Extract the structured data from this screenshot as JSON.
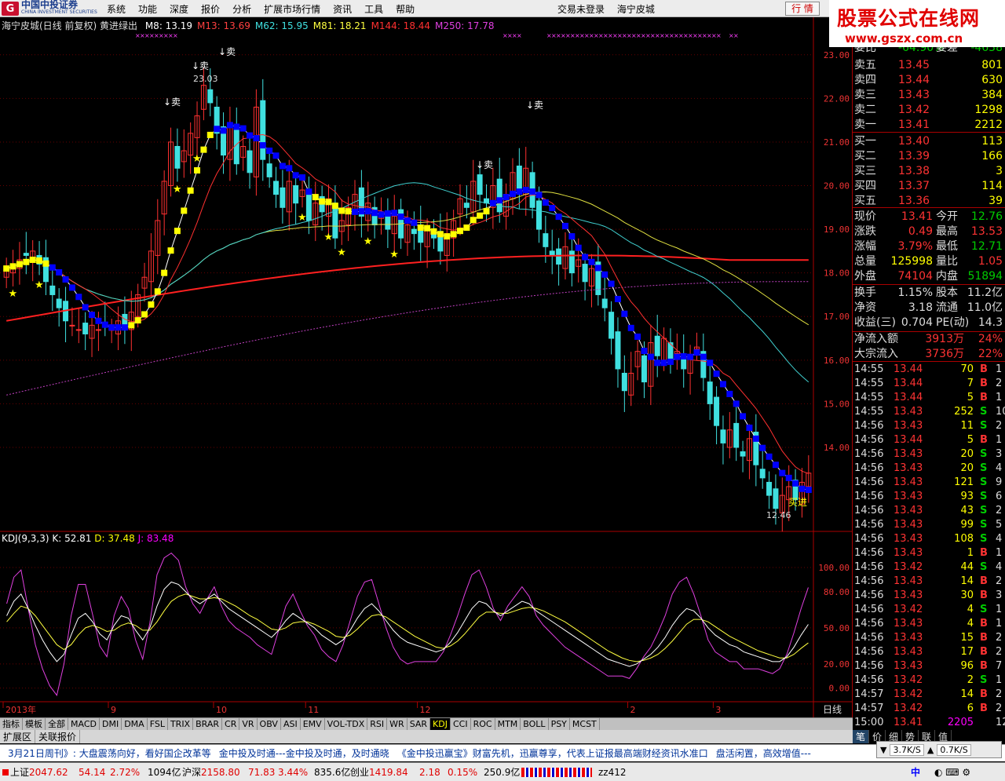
{
  "menubar": {
    "logo": "中国中投证券",
    "logo_sub": "CHINA INVESTMENT SECURITIES",
    "items": [
      "系统",
      "功能",
      "深度",
      "报价",
      "分析",
      "扩展市场行情",
      "资讯",
      "工具",
      "帮助"
    ],
    "trade_status": "交易未登录",
    "stock_name": "海宁皮城",
    "hq_button": "行 情"
  },
  "brand": {
    "title": "股票公式在线网",
    "url": "www.gszx.com.cn"
  },
  "chart": {
    "title": "海宁皮城(日线 前复权) 黄进绿出",
    "ma": [
      {
        "label": "M8: 13.19",
        "color": "#ffffff"
      },
      {
        "label": "M13: 13.69",
        "color": "#ff4040"
      },
      {
        "label": "M62: 15.95",
        "color": "#40e0e0"
      },
      {
        "label": "M81: 18.21",
        "color": "#ffff40"
      },
      {
        "label": "M144: 18.44",
        "color": "#ff3030"
      },
      {
        "label": "M250: 17.78",
        "color": "#e040e0"
      }
    ],
    "kdj_title": "KDJ(9,3,3)",
    "kdj_k": "K: 52.81",
    "kdj_d": "D: 37.48",
    "kdj_j": "J: 83.48",
    "high_label": "23.03",
    "low_label": "12.46",
    "sell_label": "↓卖",
    "buy_label": "买进",
    "period": "日线"
  },
  "chart_data": {
    "type": "candlestick",
    "price_axis": [
      "23.00",
      "22.00",
      "21.00",
      "20.00",
      "19.00",
      "18.00",
      "17.00",
      "16.00",
      "15.00",
      "14.00"
    ],
    "price_range": [
      12.2,
      23.5
    ],
    "kdj_axis": [
      "100.00",
      "80.00",
      "50.00",
      "20.00",
      "0.00"
    ],
    "x_labels": [
      "2013年",
      "9",
      "10",
      "11",
      "12",
      "2",
      "3"
    ],
    "close": [
      18.1,
      18.2,
      18.3,
      18.4,
      18.5,
      18.2,
      17.8,
      17.5,
      17.2,
      16.9,
      16.8,
      16.7,
      16.6,
      16.8,
      16.7,
      16.8,
      16.7,
      16.9,
      16.8,
      17.1,
      17.5,
      17.9,
      18.5,
      19.2,
      20.1,
      21.0,
      20.4,
      20.8,
      21.2,
      21.6,
      22.3,
      21.9,
      21.2,
      20.7,
      21.4,
      20.5,
      20.9,
      20.3,
      21.8,
      20.6,
      20.2,
      19.8,
      19.5,
      20.1,
      19.6,
      19.9,
      19.2,
      19.6,
      19.4,
      19.7,
      18.8,
      19.2,
      19.5,
      19.8,
      19.3,
      19.6,
      19.1,
      19.4,
      19.0,
      19.3,
      18.8,
      19.1,
      18.9,
      18.7,
      19.0,
      18.8,
      18.5,
      18.9,
      19.2,
      19.7,
      19.5,
      20.1,
      19.8,
      19.6,
      20.0,
      19.4,
      19.8,
      20.3,
      19.9,
      20.4,
      19.5,
      19.0,
      18.6,
      18.4,
      18.2,
      18.6,
      18.0,
      18.3,
      17.8,
      18.1,
      17.5,
      17.2,
      16.5,
      15.8,
      15.3,
      15.7,
      16.2,
      15.5,
      16.4,
      16.1,
      16.5,
      16.0,
      16.2,
      15.8,
      16.1,
      16.3,
      15.6,
      15.0,
      14.5,
      14.1,
      14.4,
      14.0,
      13.8,
      14.2,
      13.6,
      13.3,
      12.9,
      12.6,
      12.9,
      13.1,
      12.8,
      13.2,
      13.41
    ],
    "kdj_range": [
      -10,
      115
    ],
    "kdj_k": [
      60,
      72,
      78,
      66,
      52,
      40,
      30,
      22,
      28,
      44,
      58,
      62,
      55,
      45,
      40,
      52,
      60,
      58,
      48,
      40,
      50,
      68,
      82,
      88,
      86,
      80,
      74,
      70,
      74,
      78,
      72,
      66,
      62,
      58,
      54,
      50,
      46,
      42,
      48,
      56,
      62,
      58,
      54,
      50,
      44,
      40,
      36,
      40,
      48,
      58,
      66,
      70,
      64,
      56,
      48,
      42,
      38,
      36,
      34,
      32,
      30,
      32,
      38,
      46,
      56,
      66,
      72,
      70,
      64,
      60,
      64,
      68,
      72,
      70,
      64,
      60,
      56,
      52,
      48,
      44,
      40,
      36,
      32,
      28,
      24,
      22,
      20,
      18,
      20,
      24,
      28,
      34,
      42,
      52,
      60,
      66,
      64,
      58,
      50,
      44,
      40,
      36,
      34,
      30,
      28,
      26,
      24,
      22,
      22,
      26,
      34,
      44,
      52.81
    ],
    "kdj_d": [
      55,
      62,
      68,
      66,
      60,
      52,
      44,
      36,
      32,
      36,
      44,
      50,
      52,
      50,
      47,
      48,
      52,
      54,
      52,
      48,
      48,
      55,
      64,
      72,
      76,
      78,
      76,
      74,
      74,
      75,
      74,
      71,
      68,
      64,
      60,
      57,
      53,
      49,
      48,
      50,
      54,
      55,
      55,
      53,
      50,
      47,
      43,
      42,
      44,
      49,
      55,
      60,
      61,
      59,
      55,
      51,
      47,
      43,
      40,
      37,
      34,
      33,
      35,
      39,
      45,
      52,
      59,
      63,
      63,
      62,
      62,
      64,
      66,
      67,
      66,
      64,
      61,
      58,
      55,
      51,
      47,
      43,
      39,
      35,
      31,
      28,
      25,
      23,
      22,
      23,
      25,
      28,
      33,
      39,
      46,
      53,
      57,
      57,
      55,
      51,
      47,
      43,
      40,
      37,
      34,
      31,
      29,
      27,
      25,
      25,
      28,
      33,
      37.48
    ],
    "kdj_j": [
      70,
      92,
      98,
      66,
      36,
      16,
      2,
      -6,
      20,
      60,
      86,
      86,
      61,
      35,
      26,
      60,
      76,
      66,
      40,
      24,
      54,
      94,
      108,
      112,
      106,
      84,
      70,
      62,
      74,
      84,
      68,
      56,
      50,
      46,
      42,
      36,
      32,
      28,
      48,
      68,
      78,
      64,
      52,
      44,
      32,
      26,
      22,
      36,
      56,
      76,
      88,
      90,
      70,
      50,
      34,
      24,
      20,
      22,
      22,
      22,
      22,
      30,
      44,
      60,
      78,
      94,
      98,
      84,
      66,
      56,
      68,
      76,
      84,
      76,
      60,
      52,
      46,
      40,
      34,
      30,
      26,
      22,
      18,
      14,
      10,
      10,
      10,
      8,
      16,
      26,
      34,
      46,
      60,
      78,
      88,
      92,
      78,
      60,
      40,
      30,
      26,
      22,
      22,
      16,
      16,
      16,
      14,
      12,
      16,
      28,
      46,
      66,
      83.48
    ]
  },
  "quote": {
    "weibi_label": "委比",
    "weibi_val": "-64.90%",
    "weicha_label": "委差",
    "weicha_val": "-4638",
    "sell": [
      {
        "l": "卖五",
        "p": "13.45",
        "v": "801"
      },
      {
        "l": "卖四",
        "p": "13.44",
        "v": "630"
      },
      {
        "l": "卖三",
        "p": "13.43",
        "v": "384"
      },
      {
        "l": "卖二",
        "p": "13.42",
        "v": "1298"
      },
      {
        "l": "卖一",
        "p": "13.41",
        "v": "2212"
      }
    ],
    "buy": [
      {
        "l": "买一",
        "p": "13.40",
        "v": "113"
      },
      {
        "l": "买二",
        "p": "13.39",
        "v": "166"
      },
      {
        "l": "买三",
        "p": "13.38",
        "v": "3"
      },
      {
        "l": "买四",
        "p": "13.37",
        "v": "114"
      },
      {
        "l": "买五",
        "p": "13.36",
        "v": "39"
      }
    ],
    "fields": [
      {
        "a": "现价",
        "b": "13.41",
        "bc": "#f33",
        "c": "今开",
        "d": "12.76",
        "dc": "#0c0"
      },
      {
        "a": "涨跌",
        "b": "0.49",
        "bc": "#f33",
        "c": "最高",
        "d": "13.53",
        "dc": "#f33"
      },
      {
        "a": "涨幅",
        "b": "3.79%",
        "bc": "#f33",
        "c": "最低",
        "d": "12.71",
        "dc": "#0c0"
      },
      {
        "a": "总量",
        "b": "125998",
        "bc": "#ff0",
        "c": "量比",
        "d": "1.05",
        "dc": "#f33"
      },
      {
        "a": "外盘",
        "b": "74104",
        "bc": "#f33",
        "c": "内盘",
        "d": "51894",
        "dc": "#0c0"
      }
    ],
    "fields2": [
      {
        "a": "换手",
        "b": "1.15%",
        "bc": "#ddd",
        "c": "股本",
        "d": "11.2亿",
        "dc": "#ddd"
      },
      {
        "a": "净资",
        "b": "3.18",
        "bc": "#ddd",
        "c": "流通",
        "d": "11.0亿",
        "dc": "#ddd"
      },
      {
        "a": "收益(三)",
        "b": "0.704",
        "bc": "#ddd",
        "c": "PE(动)",
        "d": "14.3",
        "dc": "#ddd"
      }
    ],
    "flow": [
      {
        "a": "净流入额",
        "b": "3913万",
        "c": "24%"
      },
      {
        "a": "大宗流入",
        "b": "3736万",
        "c": "22%"
      }
    ],
    "ticks": [
      [
        "14:55",
        "13.44",
        "70",
        "B",
        "1"
      ],
      [
        "14:55",
        "13.44",
        "7",
        "B",
        "2"
      ],
      [
        "14:55",
        "13.44",
        "5",
        "B",
        "1"
      ],
      [
        "14:55",
        "13.43",
        "252",
        "S",
        "10"
      ],
      [
        "14:56",
        "13.43",
        "11",
        "S",
        "2"
      ],
      [
        "14:56",
        "13.44",
        "5",
        "B",
        "1"
      ],
      [
        "14:56",
        "13.43",
        "20",
        "S",
        "3"
      ],
      [
        "14:56",
        "13.43",
        "20",
        "S",
        "4"
      ],
      [
        "14:56",
        "13.43",
        "121",
        "S",
        "9"
      ],
      [
        "14:56",
        "13.43",
        "93",
        "S",
        "6"
      ],
      [
        "14:56",
        "13.43",
        "43",
        "S",
        "2"
      ],
      [
        "14:56",
        "13.43",
        "99",
        "S",
        "5"
      ],
      [
        "14:56",
        "13.43",
        "108",
        "S",
        "4"
      ],
      [
        "14:56",
        "13.43",
        "1",
        "B",
        "1"
      ],
      [
        "14:56",
        "13.42",
        "44",
        "S",
        "4"
      ],
      [
        "14:56",
        "13.43",
        "14",
        "B",
        "2"
      ],
      [
        "14:56",
        "13.43",
        "30",
        "B",
        "3"
      ],
      [
        "14:56",
        "13.42",
        "4",
        "S",
        "1"
      ],
      [
        "14:56",
        "13.43",
        "4",
        "B",
        "1"
      ],
      [
        "14:56",
        "13.43",
        "15",
        "B",
        "2"
      ],
      [
        "14:56",
        "13.43",
        "17",
        "B",
        "2"
      ],
      [
        "14:56",
        "13.43",
        "96",
        "B",
        "7"
      ],
      [
        "14:56",
        "13.42",
        "2",
        "S",
        "1"
      ],
      [
        "14:57",
        "13.42",
        "14",
        "B",
        "2"
      ],
      [
        "14:57",
        "13.42",
        "6",
        "B",
        "2"
      ],
      [
        "15:00",
        "13.41",
        "2205",
        "",
        "128"
      ]
    ]
  },
  "tabs": [
    "指标",
    "模板",
    "全部",
    "MACD",
    "DMI",
    "DMA",
    "FSL",
    "TRIX",
    "BRAR",
    "CR",
    "VR",
    "OBV",
    "ASI",
    "EMV",
    "VOL-TDX",
    "RSI",
    "WR",
    "SAR",
    "KDJ",
    "CCI",
    "ROC",
    "MTM",
    "BOLL",
    "PSY",
    "MCST"
  ],
  "tabs_active": "KDJ",
  "tabs2": [
    "扩展区",
    "关联报价"
  ],
  "rtabs": [
    "笔",
    "价",
    "细",
    "势",
    "联",
    "值"
  ],
  "ticker": [
    "3月21日周刊》: 大盘震荡向好，看好国企改革等",
    "金中投及时通---金中投及时通，及时通晓",
    "《金中投迅赢宝》财富先机，迅赢尊享，代表上证报最高端财经资讯水准口",
    "盘活闲置，高效增值---"
  ],
  "speed": {
    "a": "3.7K/S",
    "b": "0.7K/S"
  },
  "status": {
    "sh_label": "上证",
    "sh_val": "2047.62",
    "sh_chg": "54.14",
    "sh_pct": "2.72%",
    "sh_amt": "1094亿",
    "sz_label": "沪深",
    "sz_val": "2158.80",
    "sz_chg": "71.83",
    "sz_pct": "3.44%",
    "sz_amt": "835.6亿",
    "cy_label": "创业",
    "cy_val": "1419.84",
    "cy_chg": "2.18",
    "cy_pct": "0.15%",
    "cy_amt": "250.9亿",
    "user": "zz412",
    "ime": "中"
  }
}
